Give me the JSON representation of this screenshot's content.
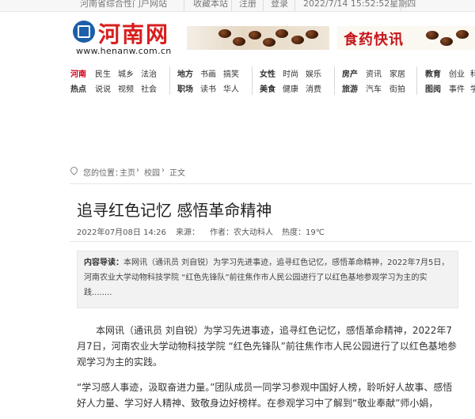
{
  "topbar": {
    "site_name": "河南省综合性门户网站",
    "links": [
      "收藏本站",
      "注册",
      "登录"
    ],
    "datetime": "2022/7/14 15:52:52星期四"
  },
  "logo": {
    "text": "河南网",
    "url": "www.henanw.com.cn"
  },
  "banner": {
    "text": "食药快讯"
  },
  "nav": {
    "group1": {
      "row1": [
        "河南",
        "民生",
        "城乡",
        "法治"
      ],
      "row2": [
        "热点",
        "说说",
        "视频",
        "社会"
      ]
    },
    "group2": {
      "row1": [
        "地方",
        "书画",
        "搞笑"
      ],
      "row2": [
        "职场",
        "读书",
        "华人"
      ]
    },
    "group3": {
      "row1": [
        "女性",
        "时尚",
        "娱乐"
      ],
      "row2": [
        "美食",
        "健康",
        "消费"
      ]
    },
    "group4": {
      "row1": [
        "房产",
        "资讯",
        "家居"
      ],
      "row2": [
        "旅游",
        "汽车",
        "街拍"
      ]
    },
    "group5": {
      "row1": [
        "教育",
        "创业",
        "科"
      ],
      "row2": [
        "图阅",
        "事件",
        "学"
      ]
    }
  },
  "breadcrumb": {
    "prefix": "您的位置：",
    "home": "主页",
    "section": "校园",
    "current": "正文",
    "sep": "›"
  },
  "article": {
    "title": "追寻红色记忆 感悟革命精神",
    "date": "2022年07月08日 14:26",
    "source": "来源：",
    "author": "作者：农大动科人",
    "views": "热度：19℃",
    "summary_label": "内容导读：",
    "summary": "本网讯（通讯员 刘自锐）为学习先进事迹，追寻红色记忆，感悟革命精神，2022年7月5日，河南农业大学动物科技学院 “红色先锋队”前往焦作市人民公园进行了以红色基地参观学习为主的实践........",
    "para1": "本网讯（通讯员 刘自锐）为学习先进事迹，追寻红色记忆，感悟革命精神，2022年7月7日，河南农业大学动物科技学院 “红色先锋队”前往焦作市人民公园进行了以红色基地参观学习为主的实践。",
    "para2": "“学习感人事迹，汲取奋进力量。”团队成员一同学习参观中国好人榜，聆听好人故事、感悟好人力量、学习好人精神、致敬身边好榜样。在参观学习中了解到“敬业奉献”师小娟，"
  }
}
